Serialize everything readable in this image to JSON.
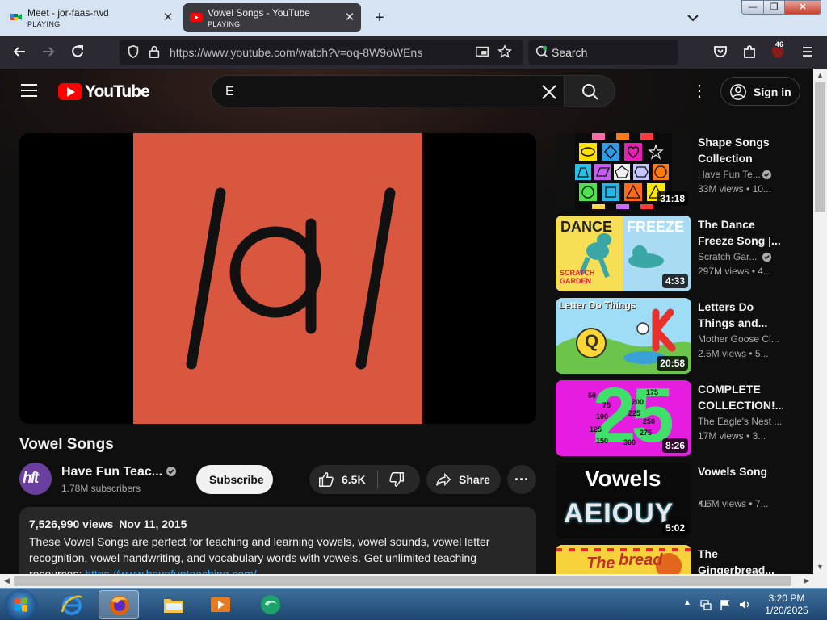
{
  "browser": {
    "tabs": [
      {
        "title": "Meet - jor-faas-rwd",
        "status": "PLAYING",
        "icon": "google-meet-icon"
      },
      {
        "title": "Vowel Songs - YouTube",
        "status": "PLAYING",
        "icon": "youtube-icon"
      }
    ],
    "url": "https://www.youtube.com/watch?v=oq-8W9oWEns",
    "search_placeholder": "Search",
    "extension_badge": "46"
  },
  "youtube": {
    "logo_text": "YouTube",
    "search_query": "E",
    "sign_in": "Sign in"
  },
  "video": {
    "title": "Vowel Songs",
    "player_glyph": "/a/",
    "channel": "Have Fun Teac...",
    "subscribers": "1.78M subscribers",
    "subscribe_label": "Subscribe",
    "likes": "6.5K",
    "share_label": "Share",
    "views": "7,526,990 views",
    "date": "Nov 11, 2015",
    "description": "These Vowel Songs are perfect for teaching and learning vowels, vowel sounds, vowel letter recognition, vowel handwriting, and vocabulary words with vowels. Get unlimited teaching",
    "description_tail": "resources: ",
    "description_link": "https://www.havefunteaching.com/"
  },
  "recommendations": [
    {
      "title1": "Shape Songs",
      "title2": "Collection",
      "channel": "Have Fun Te...",
      "verified": true,
      "views": "33M views",
      "age": "10...",
      "duration": "31:18"
    },
    {
      "title1": "The Dance",
      "title2": "Freeze Song |...",
      "channel": "Scratch Gar...",
      "verified": true,
      "views": "297M views",
      "age": "4...",
      "duration": "4:33",
      "thumb_text": [
        "DANCE",
        "FREEZE",
        "SCRATCH",
        "GARDEN"
      ]
    },
    {
      "title1": "Letters Do",
      "title2": "Things and...",
      "channel": "Mother Goose Cl...",
      "verified": false,
      "views": "2.5M views",
      "age": "5...",
      "duration": "20:58",
      "thumb_text": [
        "Letter Do Things",
        "Q",
        "K"
      ]
    },
    {
      "title1": "COMPLETE",
      "title2": "COLLECTION!...",
      "channel": "The Eagle's Nest ...",
      "verified": false,
      "views": "17M views",
      "age": "3...",
      "duration": "8:26",
      "thumb_text": [
        "25",
        "50",
        "75",
        "100",
        "125",
        "150",
        "175",
        "200",
        "225",
        "250",
        "275",
        "300"
      ]
    },
    {
      "title1": "Vowels Song",
      "title2": "",
      "channel": "KLT",
      "verified": false,
      "views": "4.6M views",
      "age": "7...",
      "duration": "5:02",
      "thumb_text": [
        "Vowels",
        "AEIOUY"
      ]
    },
    {
      "title1": "The",
      "title2": "Gingerbread...",
      "channel": "",
      "verified": false,
      "views": "",
      "age": "",
      "duration": "",
      "thumb_text": [
        "The",
        "bread"
      ]
    }
  ],
  "taskbar": {
    "time": "3:20 PM",
    "date": "1/20/2025"
  },
  "colors": {
    "youtube_red": "#ff0000",
    "player_bg": "#d9563f",
    "page_bg": "#0f0f0f",
    "link": "#3ea6ff"
  }
}
